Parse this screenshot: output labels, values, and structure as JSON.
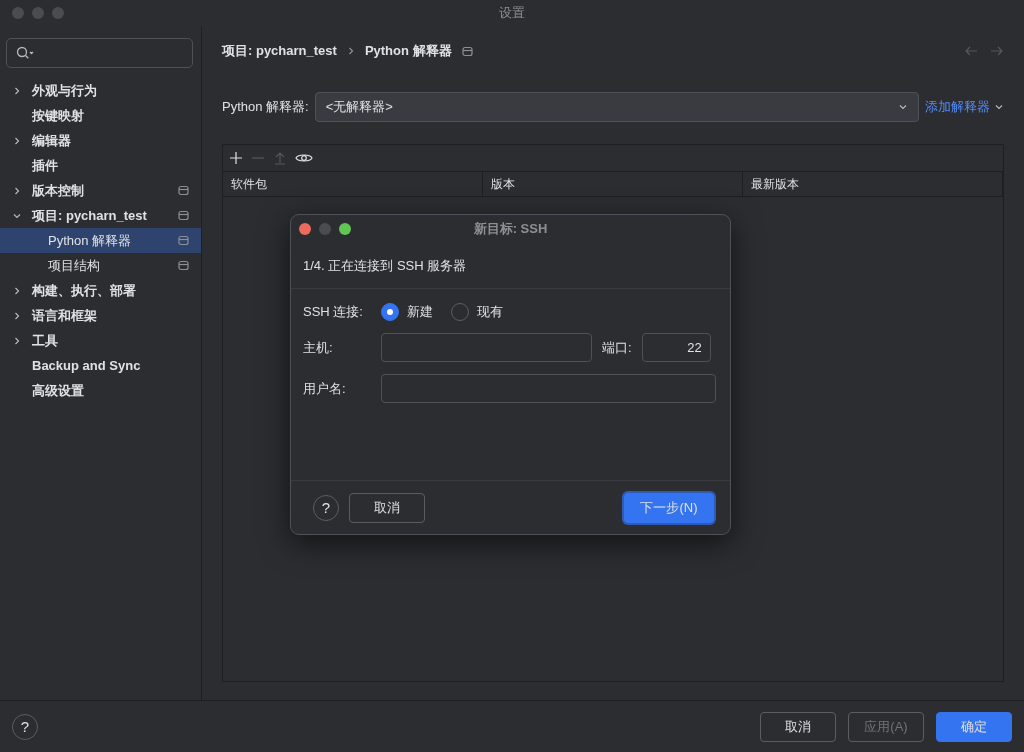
{
  "window": {
    "title": "设置"
  },
  "sidebar": {
    "items": [
      {
        "label": "外观与行为",
        "expanded": false,
        "selected": false,
        "project_scoped": false
      },
      {
        "label": "按键映射",
        "selected": false,
        "project_scoped": false
      },
      {
        "label": "编辑器",
        "expanded": false,
        "selected": false,
        "project_scoped": false
      },
      {
        "label": "插件",
        "selected": false,
        "project_scoped": false
      },
      {
        "label": "版本控制",
        "expanded": false,
        "selected": false,
        "project_scoped": true
      },
      {
        "label": "项目: pycharn_test",
        "expanded": true,
        "selected": false,
        "project_scoped": true,
        "children": [
          {
            "label": "Python 解释器",
            "selected": true,
            "project_scoped": true
          },
          {
            "label": "项目结构",
            "selected": false,
            "project_scoped": true
          }
        ]
      },
      {
        "label": "构建、执行、部署",
        "expanded": false,
        "selected": false,
        "project_scoped": false
      },
      {
        "label": "语言和框架",
        "expanded": false,
        "selected": false,
        "project_scoped": false
      },
      {
        "label": "工具",
        "expanded": false,
        "selected": false,
        "project_scoped": false
      },
      {
        "label": "Backup and Sync",
        "selected": false,
        "project_scoped": false
      },
      {
        "label": "高级设置",
        "selected": false,
        "project_scoped": false
      }
    ]
  },
  "breadcrumb": [
    "项目: pycharn_test",
    "Python 解释器"
  ],
  "interpreter": {
    "label": "Python 解释器:",
    "value": "<无解释器>",
    "add_link": "添加解释器"
  },
  "packages": {
    "columns": [
      "软件包",
      "版本",
      "最新版本"
    ]
  },
  "dialog": {
    "title": "新目标: SSH",
    "step": "1/4. 正在连接到 SSH 服务器",
    "connection": {
      "label": "SSH 连接:",
      "options": [
        {
          "label": "新建",
          "selected": true
        },
        {
          "label": "现有",
          "selected": false
        }
      ]
    },
    "host": {
      "label": "主机:"
    },
    "port": {
      "label": "端口:",
      "value": "22"
    },
    "username": {
      "label": "用户名:"
    },
    "help": "?",
    "cancel": "取消",
    "next": "下一步(N)"
  },
  "footer": {
    "help": "?",
    "buttons": [
      {
        "label": "取消",
        "kind": "secondary",
        "disabled": false
      },
      {
        "label": "应用(A)",
        "kind": "secondary",
        "disabled": true
      },
      {
        "label": "确定",
        "kind": "primary",
        "disabled": false
      }
    ]
  }
}
